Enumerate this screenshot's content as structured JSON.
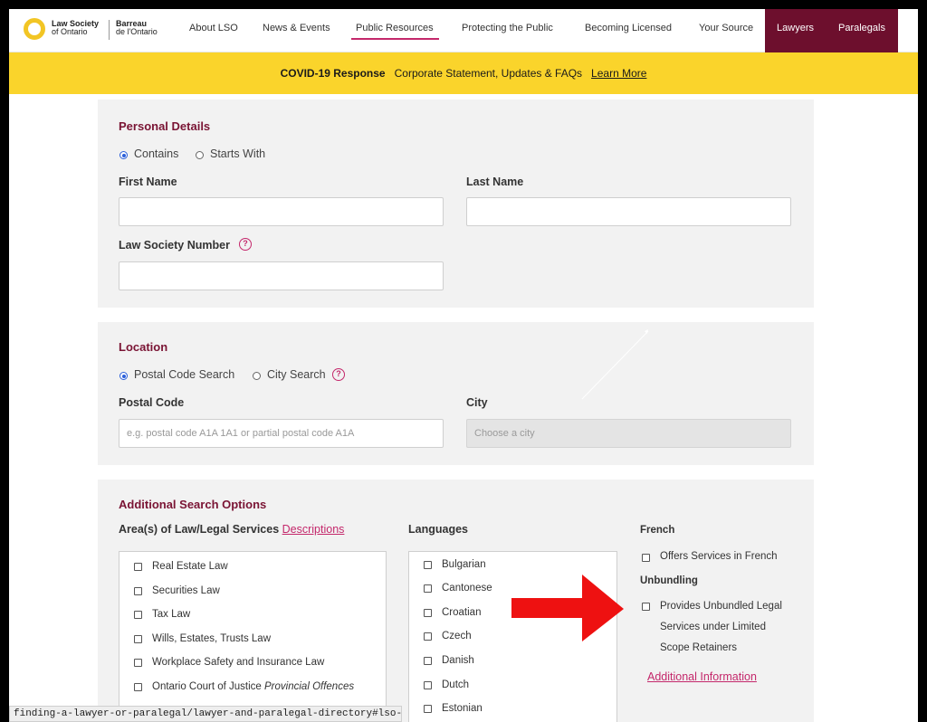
{
  "header": {
    "logo_en_line1": "Law Society",
    "logo_en_line2": "of Ontario",
    "logo_fr_line1": "Barreau",
    "logo_fr_line2": "de l'Ontario",
    "nav": [
      "About LSO",
      "News & Events",
      "Public Resources",
      "Protecting the Public",
      "Becoming Licensed",
      "Your Source"
    ],
    "nav_dark": [
      "Lawyers",
      "Paralegals"
    ],
    "colors": {
      "brand_dark": "#6d0f2d",
      "accent": "#c4286b",
      "banner": "#fad42b"
    }
  },
  "banner": {
    "title": "COVID-19 Response",
    "text": "Corporate Statement, Updates & FAQs",
    "link": "Learn More"
  },
  "personal": {
    "title": "Personal Details",
    "radio_contains": "Contains",
    "radio_starts": "Starts With",
    "first_name_label": "First Name",
    "last_name_label": "Last Name",
    "lso_number_label": "Law Society Number",
    "help": "?"
  },
  "location": {
    "title": "Location",
    "radio_postal": "Postal Code Search",
    "radio_city": "City Search",
    "postal_label": "Postal Code",
    "postal_placeholder": "e.g. postal code A1A 1A1 or partial postal code A1A",
    "city_label": "City",
    "city_placeholder": "Choose a city"
  },
  "additional": {
    "title": "Additional Search Options",
    "areas_label": "Area(s) of Law/Legal Services",
    "areas_link": "Descriptions",
    "areas": [
      "Real Estate Law",
      "Securities Law",
      "Tax Law",
      "Wills, Estates, Trusts Law",
      "Workplace Safety and Insurance Law",
      "Ontario Court of Justice"
    ],
    "areas_last_italic": "Provincial Offences",
    "languages_label": "Languages",
    "languages": [
      "Bulgarian",
      "Cantonese",
      "Croatian",
      "Czech",
      "Danish",
      "Dutch",
      "Estonian"
    ],
    "french_label": "French",
    "french_option": "Offers Services in French",
    "unbundling_label": "Unbundling",
    "unbundling_line1": "Provides Unbundled Legal",
    "unbundling_line2": "Services under Limited",
    "unbundling_line3": "Scope Retainers",
    "additional_info": "Additional Information"
  },
  "statusbar": {
    "url": "finding-a-lawyer-or-paralegal/lawyer-and-paralegal-directory#lso-as"
  }
}
